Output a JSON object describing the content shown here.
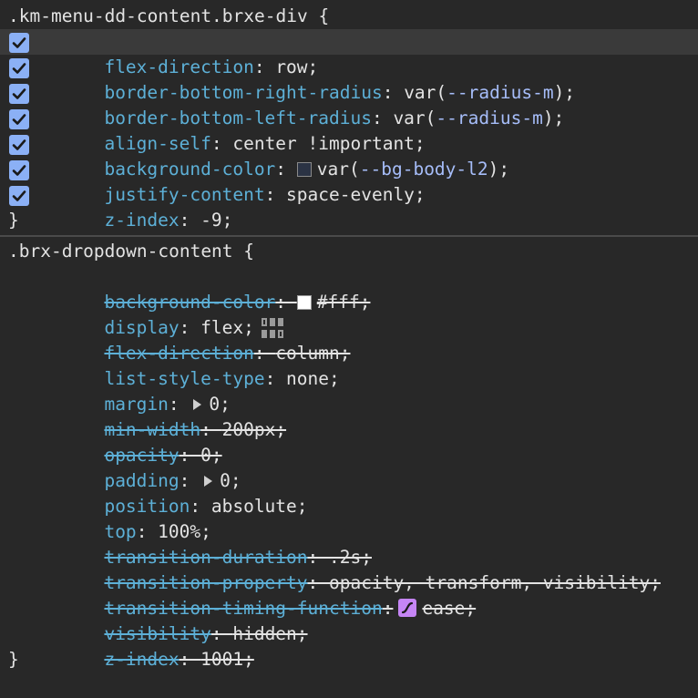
{
  "rule1": {
    "selector": ".km-menu-dd-content.brxe-div {",
    "close": "}",
    "props": [
      {
        "name": "flex-direction",
        "value": "row;",
        "checked": true
      },
      {
        "name": "border-bottom-right-radius",
        "value_prefix": "var(",
        "var": "--radius-m",
        "value_suffix": ");",
        "checked": true
      },
      {
        "name": "border-bottom-left-radius",
        "value_prefix": "var(",
        "var": "--radius-m",
        "value_suffix": ");",
        "checked": true
      },
      {
        "name": "align-self",
        "value": "center !important;",
        "checked": true
      },
      {
        "name": "background-color",
        "value_prefix": "var(",
        "var": "--bg-body-l2",
        "value_suffix": ");",
        "checked": true,
        "swatch": "#2b3344"
      },
      {
        "name": "justify-content",
        "value": "space-evenly;",
        "checked": true
      },
      {
        "name": "z-index",
        "value": "-9;",
        "checked": true
      }
    ]
  },
  "rule2": {
    "selector": ".brx-dropdown-content {",
    "close": "}",
    "props": [
      {
        "name": "background-color",
        "value": "#fff;",
        "struck": true,
        "swatch": "#ffffff"
      },
      {
        "name": "display",
        "value": "flex;",
        "struck": false,
        "icon": "flexbox-editor-icon"
      },
      {
        "name": "flex-direction",
        "value": "column;",
        "struck": true
      },
      {
        "name": "list-style-type",
        "value": "none;",
        "struck": false
      },
      {
        "name": "margin",
        "value": "0;",
        "struck": false,
        "expand": true
      },
      {
        "name": "min-width",
        "value": "200px;",
        "struck": true
      },
      {
        "name": "opacity",
        "value": "0;",
        "struck": true
      },
      {
        "name": "padding",
        "value": "0;",
        "struck": false,
        "expand": true
      },
      {
        "name": "position",
        "value": "absolute;",
        "struck": false
      },
      {
        "name": "top",
        "value": "100%;",
        "struck": false
      },
      {
        "name": "transition-duration",
        "value": ".2s;",
        "struck": true
      },
      {
        "name": "transition-property",
        "value": "opacity, transform, visibility;",
        "struck": true
      },
      {
        "name": "transition-timing-function",
        "value": "ease;",
        "struck": true,
        "icon": "easing-editor-icon"
      },
      {
        "name": "visibility",
        "value": "hidden;",
        "struck": true
      },
      {
        "name": "z-index",
        "value": "1001;",
        "struck": true
      }
    ]
  }
}
